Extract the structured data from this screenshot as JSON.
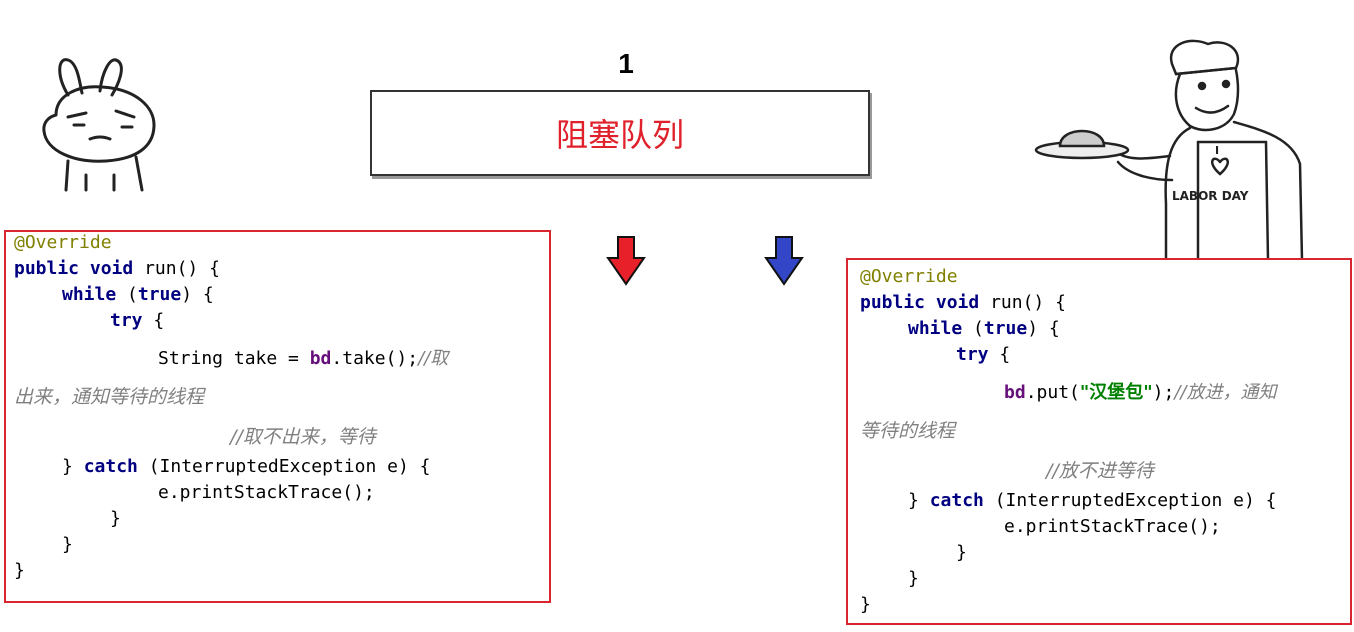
{
  "queue": {
    "count": "1",
    "label": "阻塞队列"
  },
  "consumer": {
    "annotation": "@Override",
    "kw_public": "public",
    "kw_void": "void",
    "method_sig": " run() {",
    "kw_while": "while",
    "while_open": " (",
    "kw_true": "true",
    "while_close": ") {",
    "kw_try": "try",
    "brace_open": " {",
    "stmt_pre": "String take = ",
    "field": "bd",
    "stmt_post": ".take();",
    "comment_start": "//取",
    "comment_wrap": "出来，通知等待的线程",
    "comment2": "//取不出来，等待",
    "catch_close": "} ",
    "kw_catch": "catch",
    "catch_rest": " (InterruptedException e) {",
    "print_stack": "e.printStackTrace();",
    "brace_close": "}"
  },
  "producer": {
    "annotation": "@Override",
    "kw_public": "public",
    "kw_void": "void",
    "method_sig": " run() {",
    "kw_while": "while",
    "while_open": " (",
    "kw_true": "true",
    "while_close": ") {",
    "kw_try": "try",
    "brace_open": " {",
    "field": "bd",
    "stmt_mid": ".put(",
    "string_literal": "\"汉堡包\"",
    "stmt_post": ");",
    "comment_start": "//放进，通知",
    "comment_wrap": "等待的线程",
    "comment2": "//放不进等待",
    "catch_close": "} ",
    "kw_catch": "catch",
    "catch_rest": " (InterruptedException e) {",
    "print_stack": "e.printStackTrace();",
    "brace_close": "}"
  },
  "chef_apron_text": {
    "line1": "I",
    "line2": "LABOR DAY"
  },
  "colors": {
    "queue_text": "#e0202a",
    "box_border": "#d9262e",
    "arrow_red": "#e8202a",
    "arrow_blue": "#3346c8"
  },
  "icons": [
    "rabbit-consumer-icon",
    "chef-producer-icon",
    "red-down-arrow-icon",
    "blue-down-arrow-icon"
  ]
}
